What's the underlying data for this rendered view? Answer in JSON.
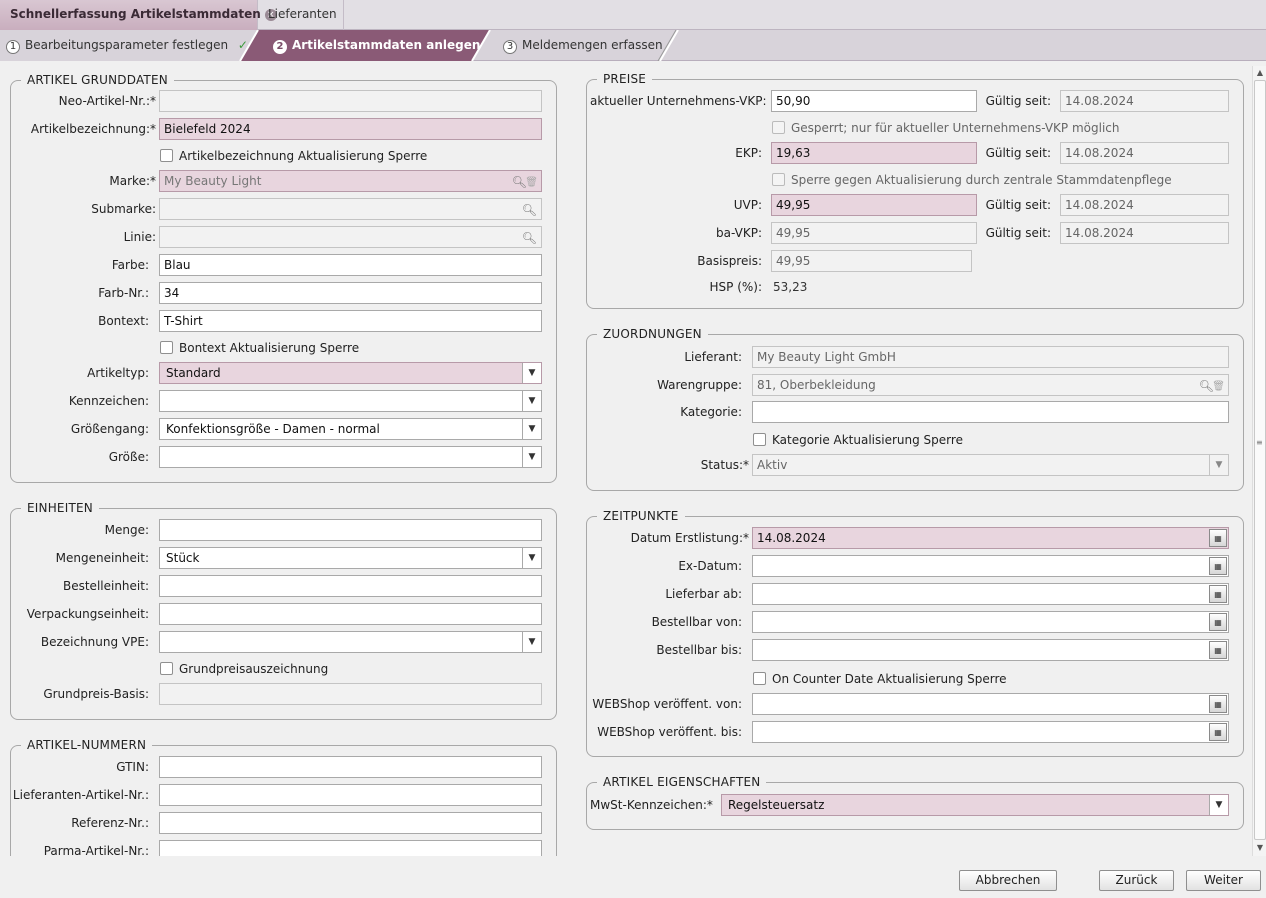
{
  "tabs": [
    {
      "label": "Schnellerfassung Artikelstammdaten",
      "close": "×"
    },
    {
      "label": "Lieferanten"
    }
  ],
  "steps": [
    {
      "num": "1",
      "label": "Bearbeitungsparameter festlegen",
      "check": "✓"
    },
    {
      "num": "2",
      "label": "Artikelstammdaten anlegen"
    },
    {
      "num": "3",
      "label": "Meldemengen erfassen"
    }
  ],
  "grunddaten": {
    "legend": "ARTIKEL GRUNDDATEN",
    "neo_label": "Neo-Artikel-Nr.:*",
    "neo_value": "",
    "bez_label": "Artikelbezeichnung:*",
    "bez_value": "Bielefeld 2024",
    "bez_lock": "Artikelbezeichnung Aktualisierung Sperre",
    "marke_label": "Marke:*",
    "marke_value": "My Beauty Light",
    "submarke_label": "Submarke:",
    "submarke_value": "",
    "linie_label": "Linie:",
    "linie_value": "",
    "farbe_label": "Farbe:",
    "farbe_value": "Blau",
    "farbnr_label": "Farb-Nr.:",
    "farbnr_value": "34",
    "bontext_label": "Bontext:",
    "bontext_value": "T-Shirt",
    "bontext_lock": "Bontext Aktualisierung Sperre",
    "typ_label": "Artikeltyp:",
    "typ_value": "Standard",
    "kenn_label": "Kennzeichen:",
    "kenn_value": "",
    "groessengang_label": "Größengang:",
    "groessengang_value": "Konfektionsgröße - Damen - normal",
    "groesse_label": "Größe:",
    "groesse_value": ""
  },
  "einheiten": {
    "legend": "EINHEITEN",
    "menge_label": "Menge:",
    "menge_value": "",
    "mengeneinheit_label": "Mengeneinheit:",
    "mengeneinheit_value": "Stück",
    "bestell_label": "Bestelleinheit:",
    "bestell_value": "",
    "verpack_label": "Verpackungseinheit:",
    "verpack_value": "",
    "vpe_label": "Bezeichnung VPE:",
    "vpe_value": "",
    "grundpreis_chk": "Grundpreisauszeichnung",
    "grundbasis_label": "Grundpreis-Basis:",
    "grundbasis_value": ""
  },
  "nummern": {
    "legend": "ARTIKEL-NUMMERN",
    "gtin_label": "GTIN:",
    "gtin_value": "",
    "lief_label": "Lieferanten-Artikel-Nr.:",
    "lief_value": "",
    "ref_label": "Referenz-Nr.:",
    "ref_value": "",
    "parma_label": "Parma-Artikel-Nr.:",
    "parma_value": ""
  },
  "preise": {
    "legend": "PREISE",
    "vkp_label": "aktueller Unternehmens-VKP:",
    "vkp_value": "50,90",
    "gueltig_label": "Gültig seit:",
    "vkp_date": "14.08.2024",
    "gesperrt": "Gesperrt; nur für aktueller Unternehmens-VKP möglich",
    "ekp_label": "EKP:",
    "ekp_value": "19,63",
    "ekp_date": "14.08.2024",
    "sperre": "Sperre gegen Aktualisierung durch zentrale Stammdatenpflege",
    "uvp_label": "UVP:",
    "uvp_value": "49,95",
    "uvp_date": "14.08.2024",
    "bavkp_label": "ba-VKP:",
    "bavkp_value": "49,95",
    "bavkp_date": "14.08.2024",
    "basis_label": "Basispreis:",
    "basis_value": "49,95",
    "hsp_label": "HSP (%):",
    "hsp_value": "53,23"
  },
  "zuordnungen": {
    "legend": "ZUORDNUNGEN",
    "lieferant_label": "Lieferant:",
    "lieferant_value": "My Beauty Light GmbH",
    "warengruppe_label": "Warengruppe:",
    "warengruppe_value": "81, Oberbekleidung",
    "kategorie_label": "Kategorie:",
    "kategorie_value": "",
    "kategorie_lock": "Kategorie Aktualisierung Sperre",
    "status_label": "Status:*",
    "status_value": "Aktiv"
  },
  "zeitpunkte": {
    "legend": "ZEITPUNKTE",
    "erst_label": "Datum Erstlistung:*",
    "erst_value": "14.08.2024",
    "ex_label": "Ex-Datum:",
    "ex_value": "",
    "lieferbar_label": "Lieferbar ab:",
    "lieferbar_value": "",
    "bvon_label": "Bestellbar von:",
    "bvon_value": "",
    "bbis_label": "Bestellbar bis:",
    "bbis_value": "",
    "counter_lock": "On Counter Date Aktualisierung Sperre",
    "wvon_label": "WEBShop veröffent. von:",
    "wvon_value": "",
    "wbis_label": "WEBShop veröffent. bis:",
    "wbis_value": ""
  },
  "eigenschaften": {
    "legend": "ARTIKEL EIGENSCHAFTEN",
    "mwst_label": "MwSt-Kennzeichen:*",
    "mwst_value": "Regelsteuersatz"
  },
  "buttons": {
    "abbrechen": "Abbrechen",
    "zurueck": "Zurück",
    "weiter": "Weiter"
  },
  "icons": {
    "search": "search-icon",
    "trash": "trash-icon",
    "calendar": "calendar-icon",
    "dropdown": "chevron-down-icon",
    "check": "check-icon"
  },
  "colors": {
    "accent": "#7a4d68",
    "required_bg": "#e8d5de",
    "tab_active": "#c9aebe"
  }
}
